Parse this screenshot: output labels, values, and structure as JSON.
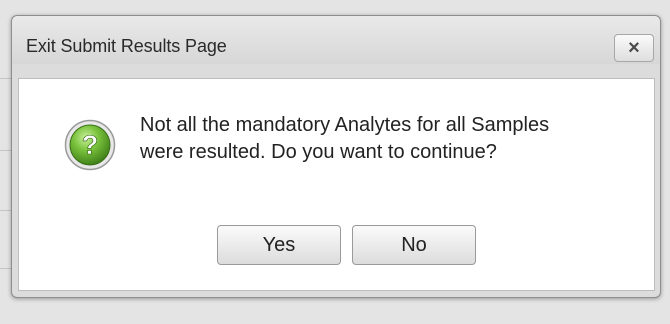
{
  "dialog": {
    "title": "Exit Submit Results Page",
    "close_label": "×",
    "message": "Not all the mandatory Analytes for all Samples were resulted. Do you want to continue?",
    "icon": "question-icon",
    "buttons": {
      "yes_label": "Yes",
      "no_label": "No"
    }
  },
  "colors": {
    "icon_green": "#5aa02c",
    "dialog_frame": "#dcdcdc",
    "content_bg": "#ffffff"
  }
}
